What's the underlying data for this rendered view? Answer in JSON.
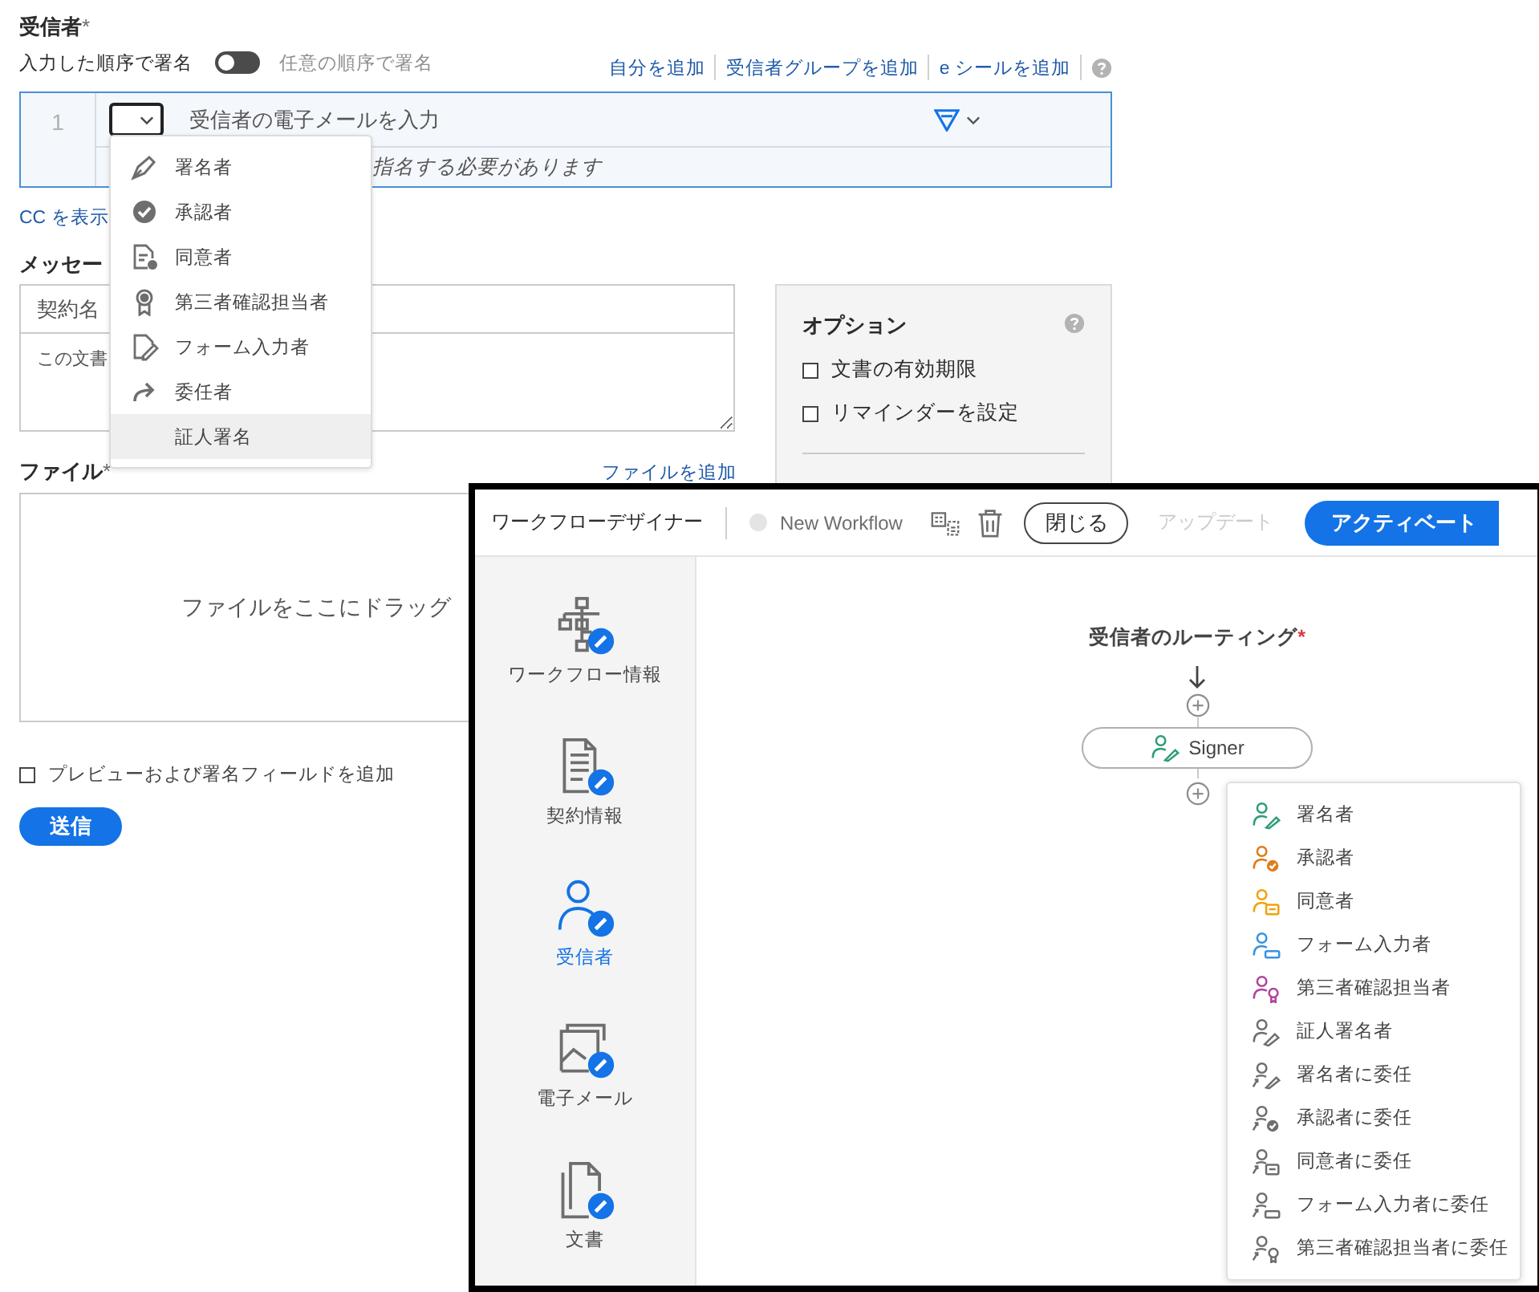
{
  "recipients": {
    "title": "受信者",
    "required_mark": "*",
    "order_label": "入力した順序で署名",
    "order_toggle": {
      "on": false
    },
    "any_order_label": "任意の順序で署名",
    "links": [
      "自分を追加",
      "受信者グループを追加",
      "e シールを追加"
    ],
    "row": {
      "number": "1",
      "email_placeholder": "受信者の電子メールを入力",
      "hint": "指名する必要があります"
    },
    "role_menu": [
      {
        "label": "署名者",
        "kind": "signer",
        "selected": false
      },
      {
        "label": "承認者",
        "kind": "approver",
        "selected": false
      },
      {
        "label": "同意者",
        "kind": "acceptor",
        "selected": false
      },
      {
        "label": "第三者確認担当者",
        "kind": "certifier",
        "selected": false
      },
      {
        "label": "フォーム入力者",
        "kind": "filler",
        "selected": false
      },
      {
        "label": "委任者",
        "kind": "delegator",
        "selected": false
      },
      {
        "label": "証人署名",
        "kind": "witness",
        "selected": true
      }
    ],
    "cc_link": "CC を表示"
  },
  "message": {
    "title": "メッセー",
    "name_placeholder": "契約名",
    "body_placeholder": "この文書"
  },
  "options": {
    "title": "オプション",
    "items": [
      {
        "label": "文書の有効期限",
        "checked": false
      },
      {
        "label": "リマインダーを設定",
        "checked": false
      }
    ]
  },
  "files": {
    "title": "ファイル",
    "required_mark": "*",
    "add_link": "ファイルを追加",
    "drop_text": "ファイルをここにドラッグ"
  },
  "preview": {
    "label": "プレビューおよび署名フィールドを追加",
    "checked": false
  },
  "send_button": "送信",
  "workflow_window": {
    "title": "ワークフローデザイナー",
    "workflow_name": "New Workflow",
    "close_button": "閉じる",
    "update_button": {
      "label": "アップデート",
      "disabled": true
    },
    "activate_button": "アクティベート",
    "nav": [
      {
        "label": "ワークフロー情報",
        "kind": "workflow",
        "selected": false
      },
      {
        "label": "契約情報",
        "kind": "agreement",
        "selected": false
      },
      {
        "label": "受信者",
        "kind": "recipients",
        "selected": true
      },
      {
        "label": "電子メール",
        "kind": "email",
        "selected": false
      },
      {
        "label": "文書",
        "kind": "documents",
        "selected": false
      }
    ],
    "routing_title": "受信者のルーティング",
    "routing_required_mark": "*",
    "node": {
      "label": "Signer",
      "kind": "signer",
      "color": "#2d9d78"
    },
    "role_menu": [
      {
        "label": "署名者",
        "kind": "signer",
        "delegate": false,
        "color": "#2d9d78"
      },
      {
        "label": "承認者",
        "kind": "approver",
        "delegate": false,
        "color": "#e07b1a"
      },
      {
        "label": "同意者",
        "kind": "acceptor",
        "delegate": false,
        "color": "#f0a30a"
      },
      {
        "label": "フォーム入力者",
        "kind": "filler",
        "delegate": false,
        "color": "#3a92e0"
      },
      {
        "label": "第三者確認担当者",
        "kind": "certifier",
        "delegate": false,
        "color": "#b0449e"
      },
      {
        "label": "証人署名者",
        "kind": "witness",
        "delegate": false,
        "color": "#6e6e6e"
      },
      {
        "label": "署名者に委任",
        "kind": "signer",
        "delegate": true,
        "color": "#6e6e6e"
      },
      {
        "label": "承認者に委任",
        "kind": "approver",
        "delegate": true,
        "color": "#6e6e6e"
      },
      {
        "label": "同意者に委任",
        "kind": "acceptor",
        "delegate": true,
        "color": "#6e6e6e"
      },
      {
        "label": "フォーム入力者に委任",
        "kind": "filler",
        "delegate": true,
        "color": "#6e6e6e"
      },
      {
        "label": "第三者確認担当者に委任",
        "kind": "certifier",
        "delegate": true,
        "color": "#6e6e6e"
      }
    ]
  }
}
